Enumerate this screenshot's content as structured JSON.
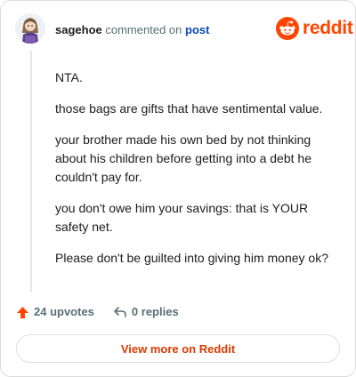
{
  "header": {
    "username": "sagehoe",
    "action_text": "commented on",
    "post_link": "post",
    "avatar_icon": "user-avatar-icon"
  },
  "brand": {
    "name": "reddit",
    "color": "#ff4500",
    "logo_icon": "reddit-snoo-icon"
  },
  "comment": {
    "paragraphs": [
      "NTA.",
      "those bags are gifts that have sentimental value.",
      "your brother made his own bed by not thinking about his children before getting into a debt he couldn't pay for.",
      "you don't owe him your savings: that is YOUR safety net.",
      "Please don't be guilted into giving him money ok?"
    ]
  },
  "actions": {
    "upvotes_label": "24 upvotes",
    "upvote_icon": "upvote-arrow-icon",
    "upvote_color": "#ff4500",
    "replies_label": "0 replies",
    "reply_icon": "reply-arrow-icon"
  },
  "footer": {
    "view_more_label": "View more on Reddit",
    "link_color": "#d93a00"
  }
}
